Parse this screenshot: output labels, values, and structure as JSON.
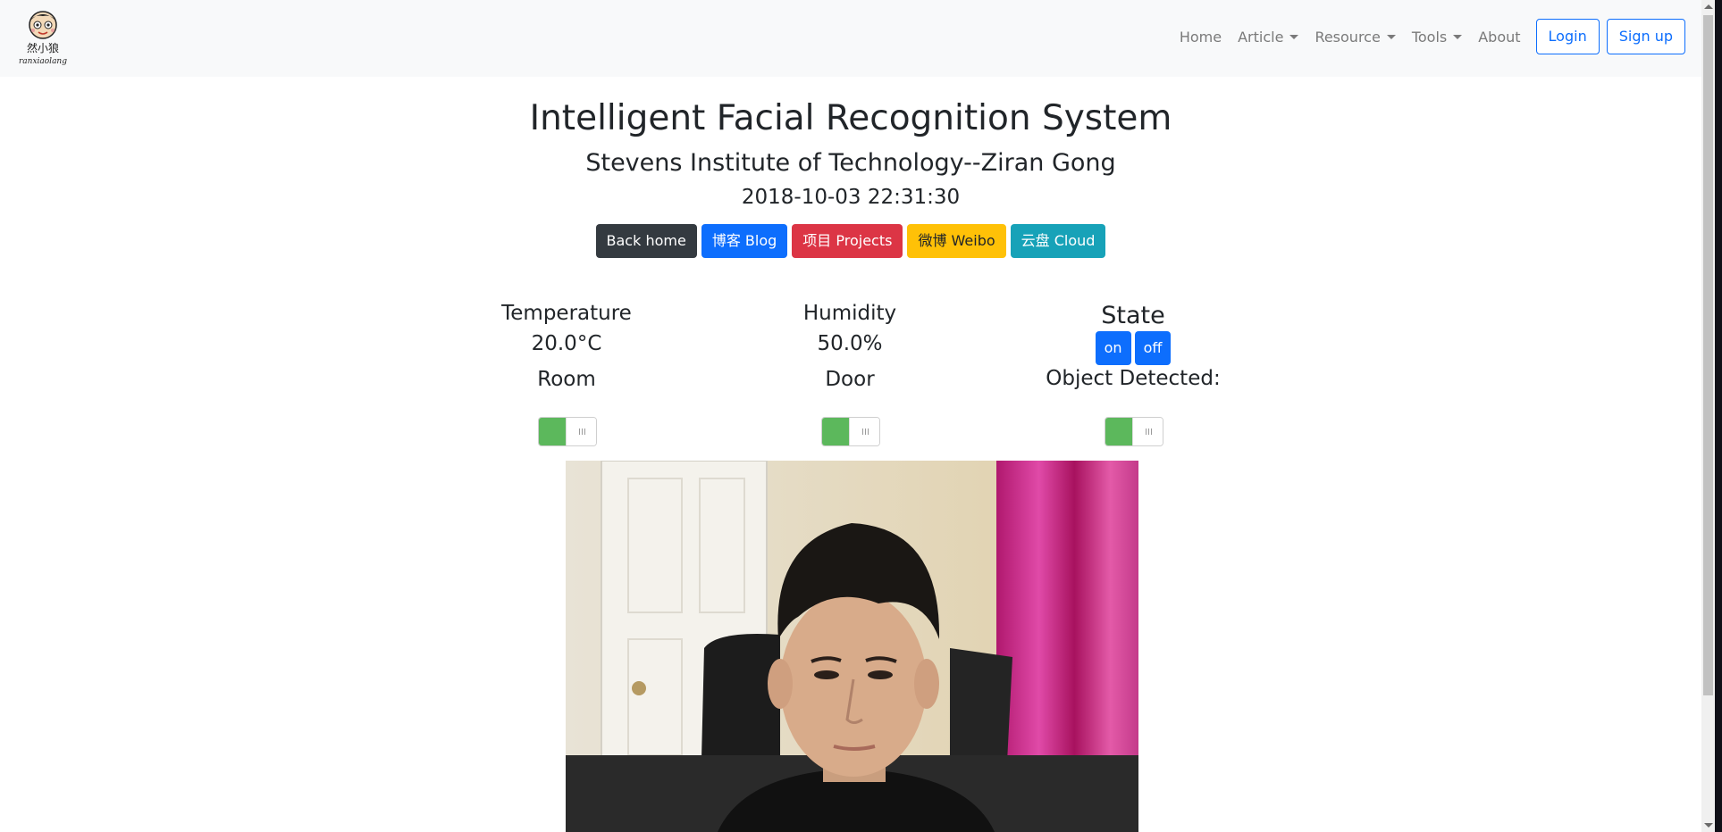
{
  "navbar": {
    "logo_text": "然小狼",
    "logo_subtext": "ranxiaolang",
    "items": [
      {
        "label": "Home",
        "dropdown": false
      },
      {
        "label": "Article",
        "dropdown": true
      },
      {
        "label": "Resource",
        "dropdown": true
      },
      {
        "label": "Tools",
        "dropdown": true
      },
      {
        "label": "About",
        "dropdown": false
      }
    ],
    "login_label": "Login",
    "signup_label": "Sign up"
  },
  "header": {
    "title": "Intelligent Facial Recognition System",
    "subtitle": "Stevens Institute of Technology--Ziran Gong",
    "datetime": "2018-10-03 22:31:30"
  },
  "links": [
    {
      "label": "Back home",
      "color": "#343a40",
      "text_color": "#ffffff"
    },
    {
      "label": "博客 Blog",
      "color": "#0d6efd",
      "text_color": "#ffffff"
    },
    {
      "label": "项目 Projects",
      "color": "#dc3545",
      "text_color": "#ffffff"
    },
    {
      "label": "微博 Weibo",
      "color": "#ffc107",
      "text_color": "#212529"
    },
    {
      "label": "云盘 Cloud",
      "color": "#17a2b8",
      "text_color": "#ffffff"
    }
  ],
  "sensors": {
    "temperature_label": "Temperature",
    "temperature_value": "20.0°C",
    "humidity_label": "Humidity",
    "humidity_value": "50.0%",
    "state_label": "State",
    "on_label": "on",
    "off_label": "off"
  },
  "switches": {
    "room_label": "Room",
    "door_label": "Door",
    "object_label": "Object Detected:",
    "room_on": true,
    "door_on": true,
    "object_on": true
  },
  "colors": {
    "primary": "#0d6efd",
    "toggle_on": "#5cb85c",
    "navbar_bg": "#f8f9fa"
  }
}
